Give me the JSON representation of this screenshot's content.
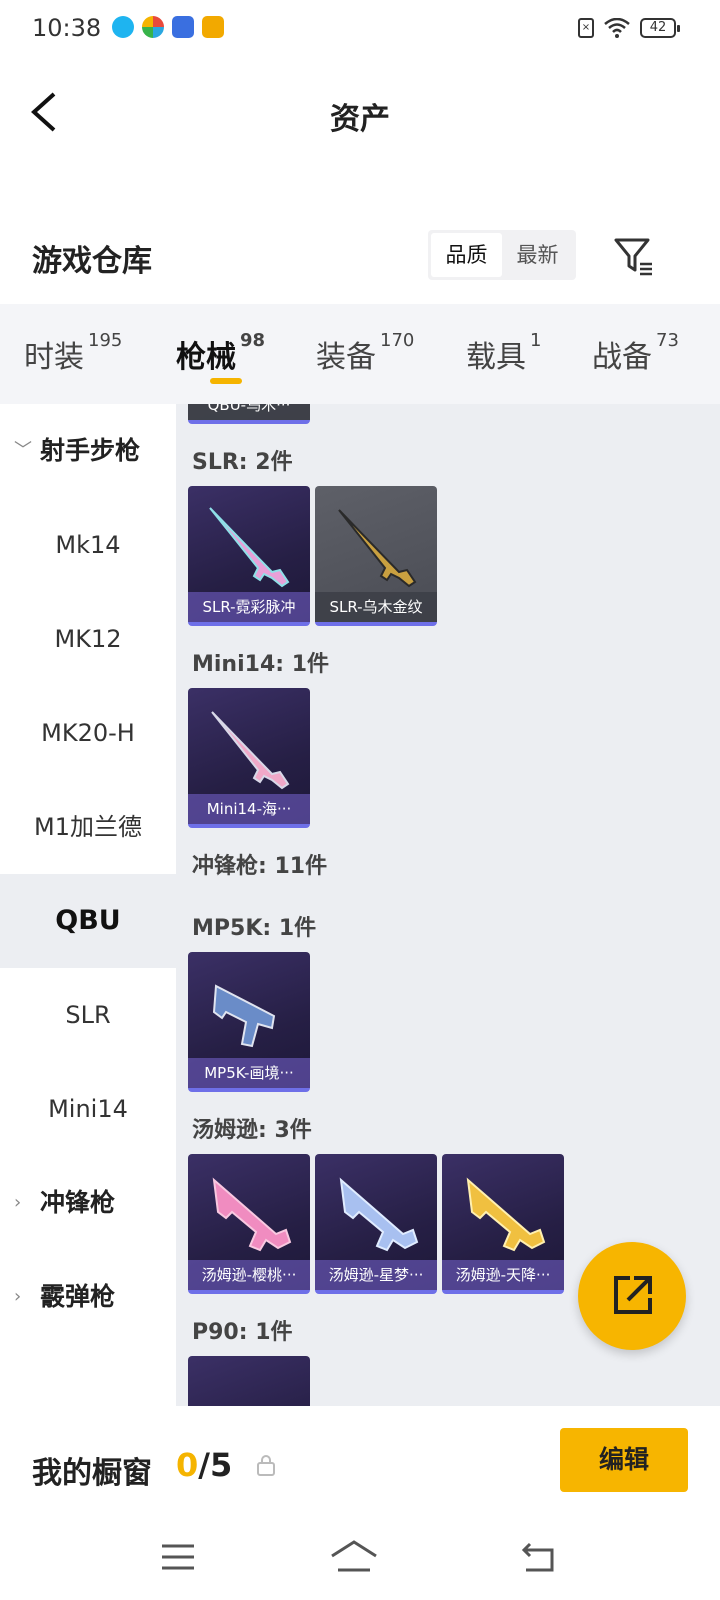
{
  "status_bar": {
    "time": "10:38",
    "battery": "42"
  },
  "header": {
    "title": "资产"
  },
  "warehouse": {
    "title": "游戏仓库",
    "sort_options": [
      "品质",
      "最新"
    ],
    "active_sort": "品质"
  },
  "tabs": [
    {
      "label": "时装",
      "count": "195"
    },
    {
      "label": "枪械",
      "count": "98"
    },
    {
      "label": "装备",
      "count": "170"
    },
    {
      "label": "载具",
      "count": "1"
    },
    {
      "label": "战备",
      "count": "73"
    }
  ],
  "active_tab": "枪械",
  "sidebar": {
    "items": [
      {
        "label": "射手步枪",
        "type": "group",
        "arrow": "expanded"
      },
      {
        "label": "Mk14"
      },
      {
        "label": "MK12"
      },
      {
        "label": "MK20-H"
      },
      {
        "label": "M1加兰德"
      },
      {
        "label": "QBU",
        "selected": true
      },
      {
        "label": "SLR"
      },
      {
        "label": "Mini14"
      },
      {
        "label": "冲锋枪",
        "type": "group",
        "arrow": "collapsed"
      },
      {
        "label": "霰弹枪",
        "type": "group",
        "arrow": "collapsed"
      }
    ]
  },
  "content": {
    "partial_top_card": "QBU-乌木···",
    "sections": [
      {
        "label": "SLR: 2件",
        "cards": [
          "SLR-霓彩脉冲",
          "SLR-乌木金纹"
        ]
      },
      {
        "label": "Mini14: 1件",
        "cards": [
          "Mini14-海···"
        ]
      },
      {
        "label": "冲锋枪: 11件",
        "cards": []
      },
      {
        "label": "MP5K: 1件",
        "cards": [
          "MP5K-画境···"
        ]
      },
      {
        "label": "汤姆逊: 3件",
        "cards": [
          "汤姆逊-樱桃···",
          "汤姆逊-星梦···",
          "汤姆逊-天降···"
        ]
      },
      {
        "label": "P90: 1件",
        "cards": []
      }
    ]
  },
  "bottom_bar": {
    "window_label": "我的橱窗",
    "count_current": "0",
    "count_total": "/5",
    "edit_label": "编辑"
  },
  "colors": {
    "accent": "#f7b500",
    "content_bg": "#eceef2",
    "card_bg": "#2b2450"
  }
}
